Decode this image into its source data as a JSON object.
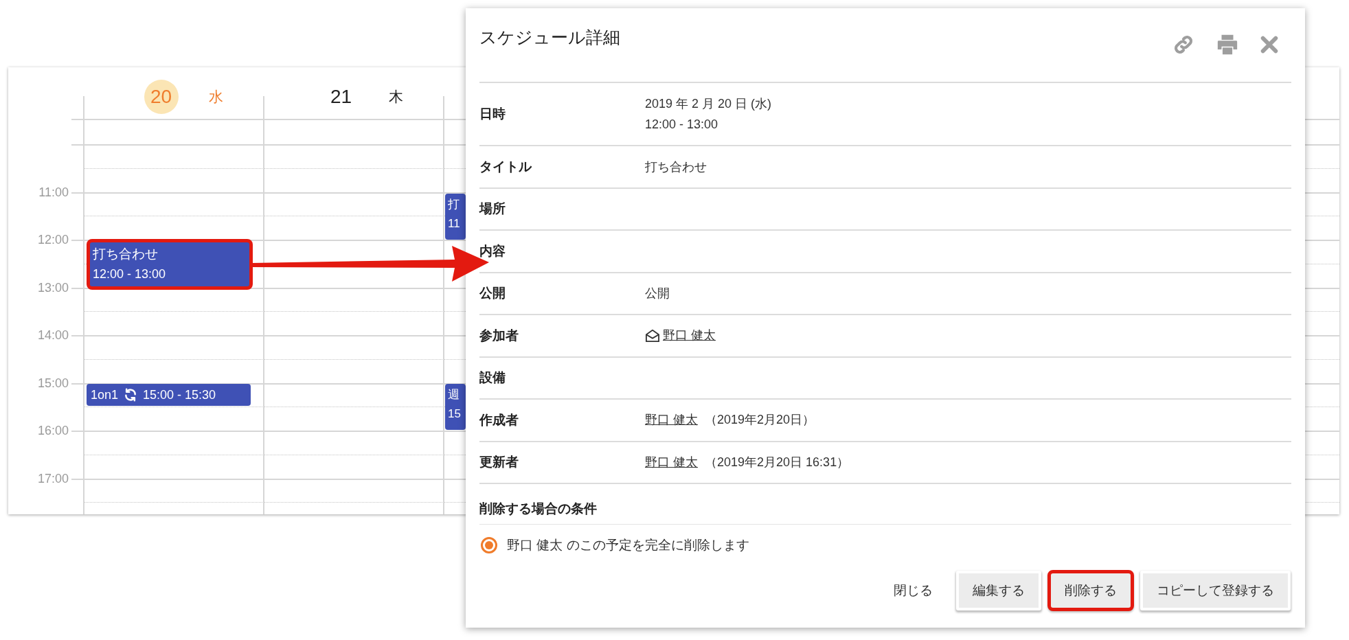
{
  "calendar": {
    "days": [
      {
        "number": "20",
        "weekday": "水",
        "today": true,
        "events": [
          {
            "title": "打ち合わせ",
            "time": "12:00 - 13:00",
            "kind": "block",
            "highlighted": true
          },
          {
            "title": "1on1",
            "time": "15:00 - 15:30",
            "kind": "inline",
            "repeating": true,
            "highlighted": false
          }
        ]
      },
      {
        "number": "21",
        "weekday": "木",
        "today": false
      }
    ],
    "column_3": {
      "events": [
        {
          "title": "打",
          "time": "11"
        },
        {
          "title": "週",
          "time": "15"
        }
      ]
    },
    "times": [
      "11:00",
      "12:00",
      "13:00",
      "14:00",
      "15:00",
      "16:00",
      "17:00"
    ]
  },
  "dialog": {
    "title": "スケジュール詳細",
    "rows": [
      {
        "label": "日時",
        "kind": "text",
        "lines": [
          "2019 年 2 月 20 日 (水)",
          "12:00 - 13:00"
        ]
      },
      {
        "label": "タイトル",
        "kind": "text",
        "lines": [
          "打ち合わせ"
        ]
      },
      {
        "label": "場所",
        "kind": "empty"
      },
      {
        "label": "内容",
        "kind": "empty"
      },
      {
        "label": "公開",
        "kind": "text",
        "lines": [
          "公開"
        ]
      },
      {
        "label": "参加者",
        "kind": "attendee",
        "name": "野口 健太"
      },
      {
        "label": "設備",
        "kind": "empty"
      },
      {
        "label": "作成者",
        "kind": "user",
        "name": "野口 健太",
        "note": "（2019年2月20日）"
      },
      {
        "label": "更新者",
        "kind": "user",
        "name": "野口 健太",
        "note": "（2019年2月20日 16:31）"
      }
    ],
    "delete_section": {
      "heading": "削除する場合の条件",
      "options": [
        {
          "label": "野口 健太 のこの予定を完全に削除します",
          "selected": true
        }
      ]
    },
    "buttons": [
      {
        "label": "閉じる",
        "kind": "text",
        "highlighted": false
      },
      {
        "label": "編集する",
        "kind": "raised",
        "highlighted": false
      },
      {
        "label": "削除する",
        "kind": "raised",
        "highlighted": true
      },
      {
        "label": "コピーして登録する",
        "kind": "raised",
        "highlighted": false
      }
    ]
  }
}
